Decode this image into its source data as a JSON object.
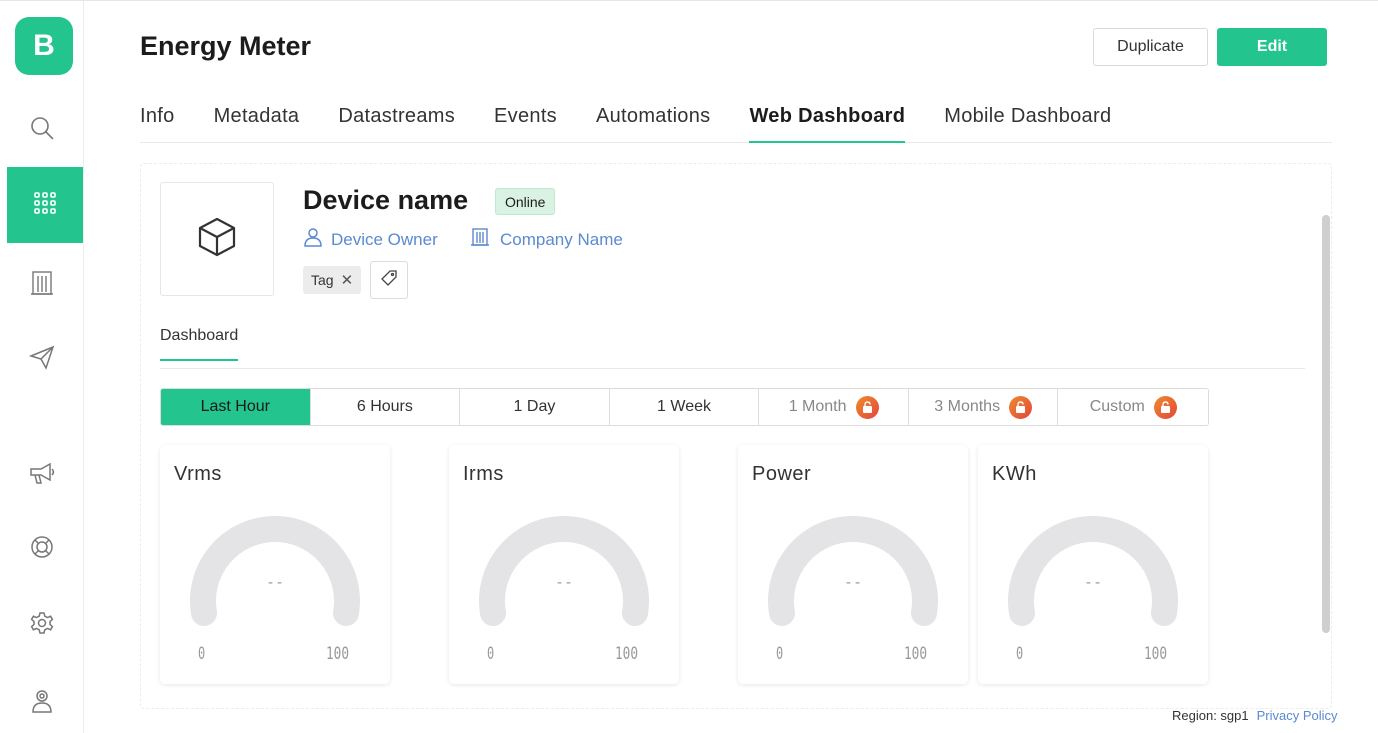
{
  "app": {
    "logo_letter": "B",
    "accent": "#23c48e"
  },
  "sidebar": {
    "items": [
      {
        "icon": "search-icon"
      },
      {
        "icon": "grid-icon",
        "active": true
      },
      {
        "icon": "building-icon"
      },
      {
        "icon": "send-icon"
      },
      {
        "icon": "megaphone-icon"
      },
      {
        "icon": "lifebuoy-icon"
      },
      {
        "icon": "gear-icon"
      },
      {
        "icon": "user-icon"
      }
    ]
  },
  "header": {
    "title": "Energy Meter",
    "duplicate_label": "Duplicate",
    "edit_label": "Edit"
  },
  "tabs": [
    {
      "label": "Info"
    },
    {
      "label": "Metadata"
    },
    {
      "label": "Datastreams"
    },
    {
      "label": "Events"
    },
    {
      "label": "Automations"
    },
    {
      "label": "Web Dashboard",
      "active": true
    },
    {
      "label": "Mobile Dashboard"
    }
  ],
  "device": {
    "name": "Device name",
    "status": "Online",
    "owner": "Device Owner",
    "company": "Company Name",
    "tag": "Tag"
  },
  "dashboard": {
    "tab_label": "Dashboard",
    "periods": [
      {
        "label": "Last Hour",
        "active": true,
        "locked": false
      },
      {
        "label": "6 Hours",
        "locked": false
      },
      {
        "label": "1 Day",
        "locked": false
      },
      {
        "label": "1 Week",
        "locked": false
      },
      {
        "label": "1 Month",
        "locked": true
      },
      {
        "label": "3 Months",
        "locked": true
      },
      {
        "label": "Custom",
        "locked": true
      }
    ],
    "widgets": [
      {
        "title": "Vrms",
        "value": "--",
        "min": "0",
        "max": "100"
      },
      {
        "title": "Irms",
        "value": "--",
        "min": "0",
        "max": "100"
      },
      {
        "title": "Power",
        "value": "--",
        "min": "0",
        "max": "100"
      },
      {
        "title": "KWh",
        "value": "--",
        "min": "0",
        "max": "100"
      }
    ]
  },
  "footer": {
    "region": "Region: sgp1",
    "privacy": "Privacy Policy"
  }
}
